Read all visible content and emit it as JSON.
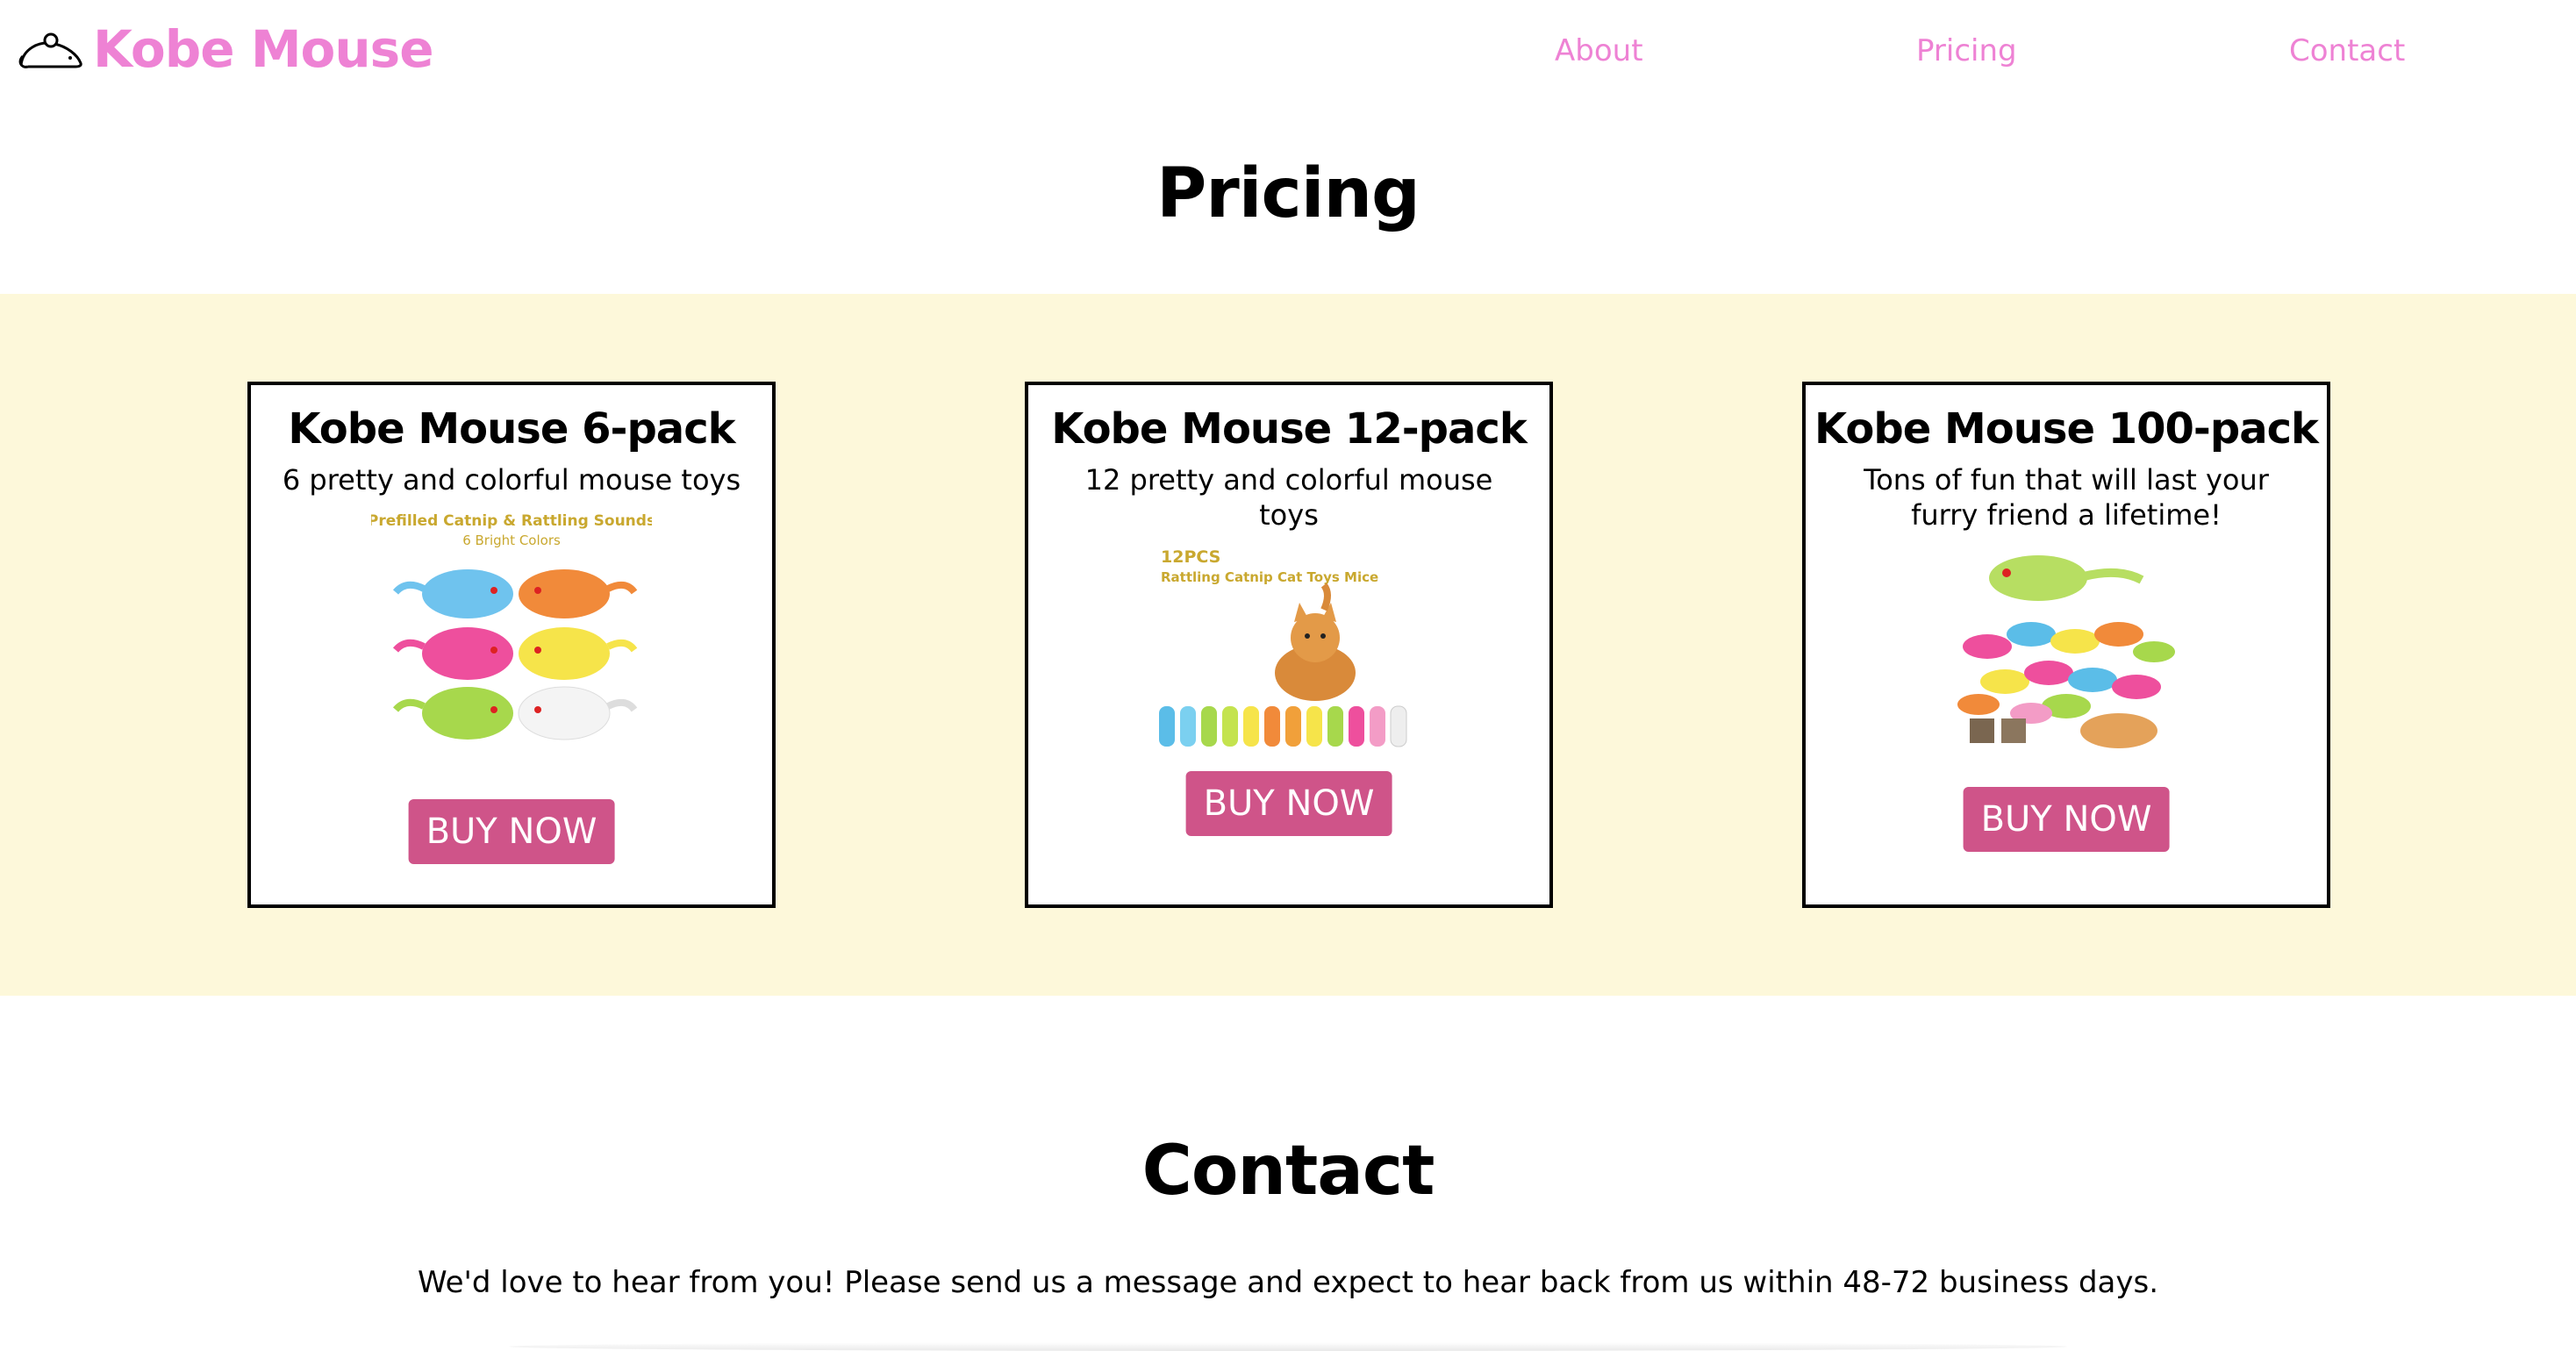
{
  "header": {
    "brand": "Kobe Mouse",
    "logo_icon": "mouse-outline-icon",
    "nav": [
      "About",
      "Pricing",
      "Contact"
    ],
    "accent_color": "#ee82d4"
  },
  "pricing": {
    "title": "Pricing",
    "band_color": "#fdf8da",
    "button_color": "#cf5489",
    "cards": [
      {
        "title": "Kobe Mouse 6-pack",
        "description": "6 pretty and colorful mouse toys",
        "image_caption_1": "Prefilled Catnip & Rattling Sounds",
        "image_caption_2": "6 Bright Colors",
        "button": "BUY NOW"
      },
      {
        "title": "Kobe Mouse 12-pack",
        "description": "12 pretty and colorful mouse toys",
        "image_caption_1": "12PCS",
        "image_caption_2": "Rattling Catnip Cat Toys Mice",
        "button": "BUY NOW"
      },
      {
        "title": "Kobe Mouse 100-pack",
        "description": "Tons of fun that will last your furry friend a lifetime!",
        "button": "BUY NOW"
      }
    ]
  },
  "contact": {
    "title": "Contact",
    "text": "We'd love to hear from you! Please send us a message and expect to hear back from us within 48-72 business days."
  }
}
